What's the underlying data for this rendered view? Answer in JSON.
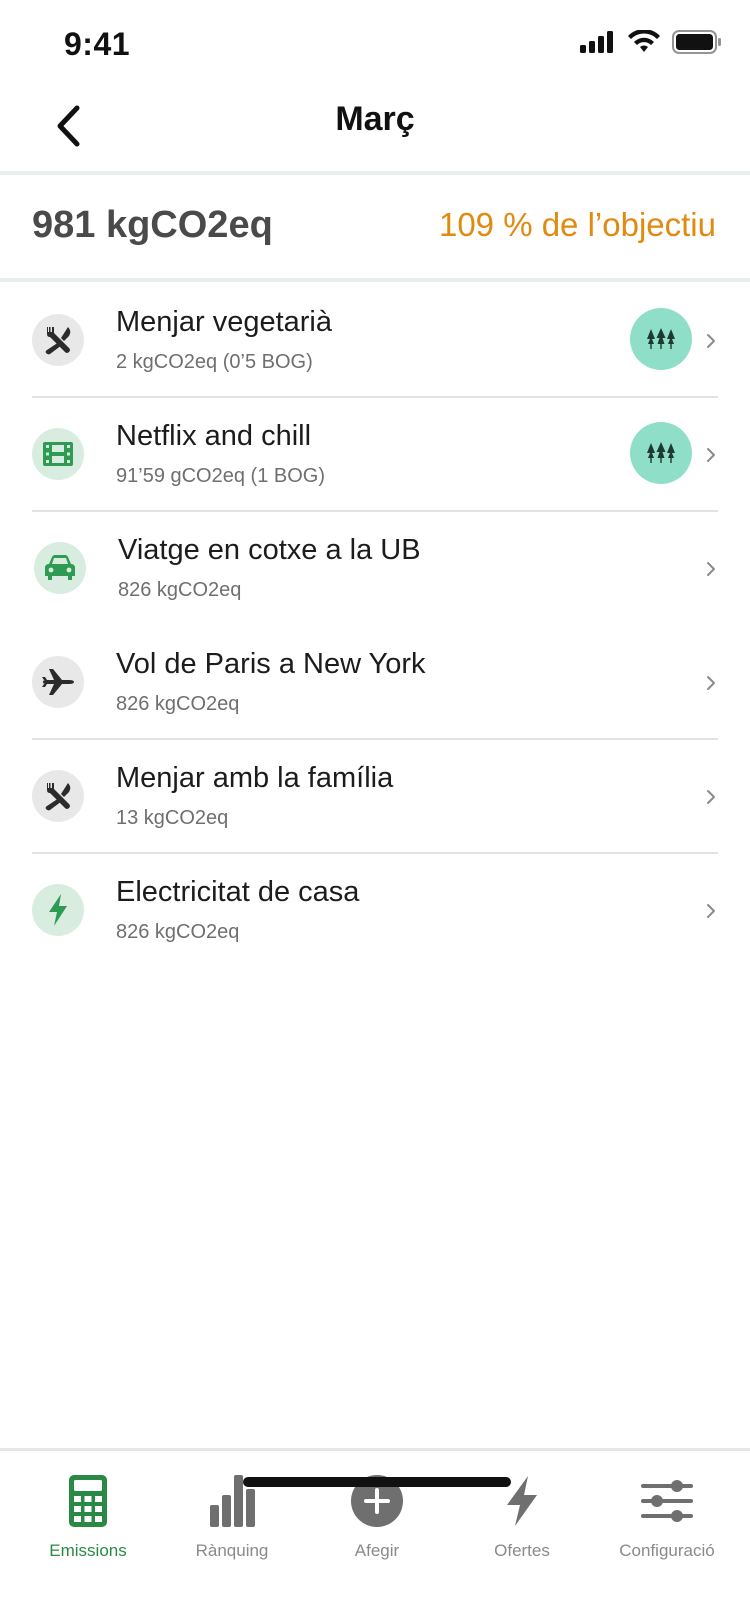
{
  "status": {
    "time": "9:41"
  },
  "header": {
    "title": "Març"
  },
  "summary": {
    "total": "981 kgCO2eq",
    "goal": "109 % de l’objectiu"
  },
  "colors": {
    "accent_green": "#2a8a45",
    "goal_orange": "#e08a10",
    "badge_teal": "#8fdfc8"
  },
  "activities": [
    {
      "title": "Menjar vegetarià",
      "subtitle": "2 kgCO2eq (0’5 BOG)",
      "icon": "food-icon",
      "badge": "trees-icon"
    },
    {
      "title": "Netflix and chill",
      "subtitle": "91’59 gCO2eq (1 BOG)",
      "icon": "film-icon",
      "badge": "trees-icon"
    },
    {
      "title": "Viatge en cotxe a la UB",
      "subtitle": "826 kgCO2eq",
      "icon": "car-icon"
    },
    {
      "title": "Vol de Paris a New York",
      "subtitle": "826 kgCO2eq",
      "icon": "plane-icon"
    },
    {
      "title": "Menjar amb la família",
      "subtitle": "13 kgCO2eq",
      "icon": "food-icon"
    },
    {
      "title": "Electricitat de casa",
      "subtitle": "826 kgCO2eq",
      "icon": "bolt-icon"
    }
  ],
  "tabs": [
    {
      "label": "Emissions",
      "icon": "calculator-icon",
      "active": true
    },
    {
      "label": "Rànquing",
      "icon": "bar-chart-icon"
    },
    {
      "label": "Afegir",
      "icon": "plus-circle-icon"
    },
    {
      "label": "Ofertes",
      "icon": "bolt-icon"
    },
    {
      "label": "Configuració",
      "icon": "sliders-icon"
    }
  ]
}
